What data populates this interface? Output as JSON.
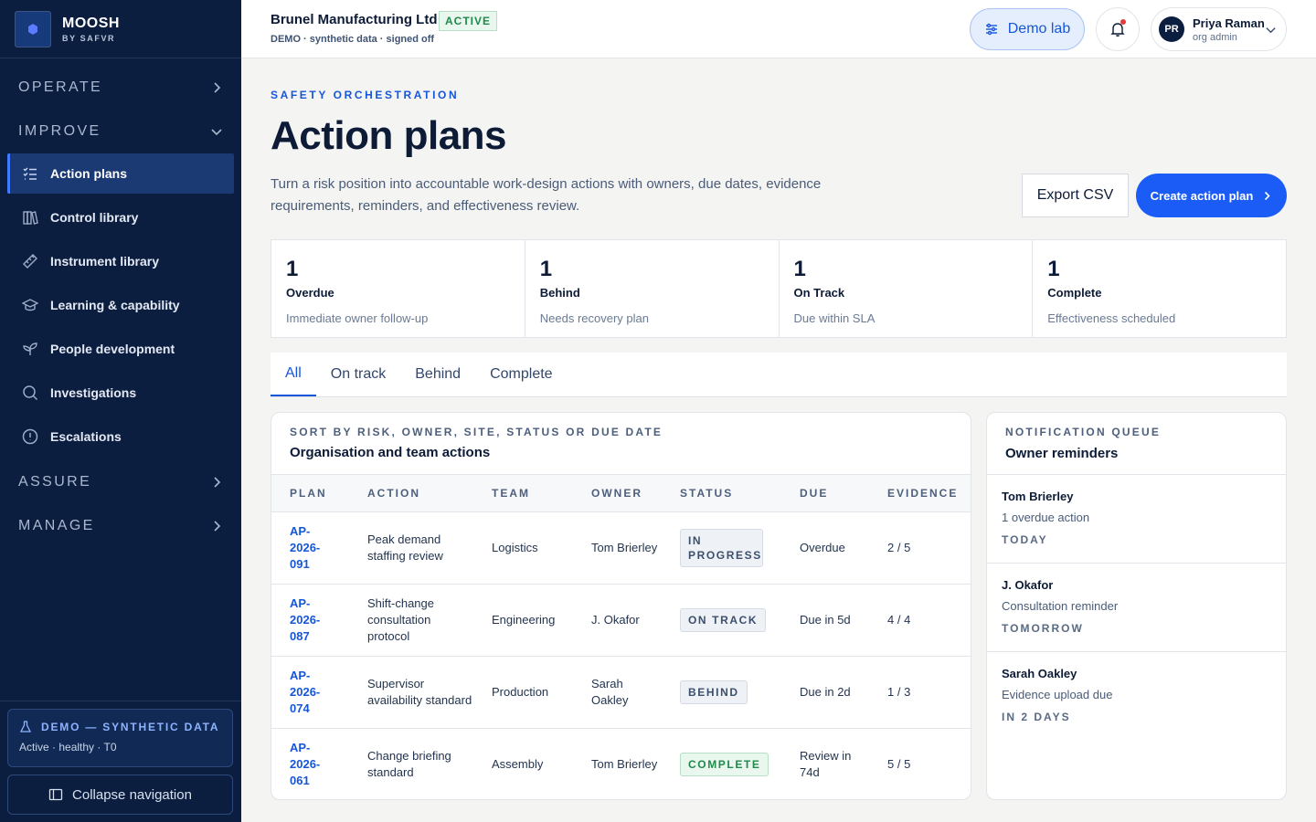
{
  "brand": {
    "name": "MOOSH",
    "sub": "BY SAFVR"
  },
  "sidebar": {
    "groups": [
      {
        "label": "OPERATE"
      },
      {
        "label": "IMPROVE"
      },
      {
        "label": "ASSURE"
      },
      {
        "label": "MANAGE"
      }
    ],
    "items": [
      {
        "label": "Action plans",
        "icon": "checklist-icon"
      },
      {
        "label": "Control library",
        "icon": "books-icon"
      },
      {
        "label": "Instrument library",
        "icon": "ruler-icon"
      },
      {
        "label": "Learning & capability",
        "icon": "graduation-cap-icon"
      },
      {
        "label": "People development",
        "icon": "sprout-icon"
      },
      {
        "label": "Investigations",
        "icon": "search-icon"
      },
      {
        "label": "Escalations",
        "icon": "alert-circle-icon"
      }
    ],
    "demo": {
      "title": "DEMO — SYNTHETIC DATA",
      "status": "Active · healthy · T0"
    },
    "collapse_label": "Collapse navigation"
  },
  "topbar": {
    "org_name": "Brunel Manufacturing Ltd",
    "org_status": "ACTIVE",
    "org_sub": "DEMO · synthetic data · signed off",
    "demo_lab": "Demo lab",
    "user": {
      "initials": "PR",
      "name": "Priya Raman",
      "role": "org admin"
    }
  },
  "header": {
    "eyebrow": "SAFETY ORCHESTRATION",
    "title": "Action plans",
    "description": "Turn a risk position into accountable work-design actions with owners, due dates, evidence requirements, reminders, and effectiveness review.",
    "export_label": "Export CSV",
    "create_label": "Create action plan"
  },
  "stats": [
    {
      "value": "1",
      "label": "Overdue",
      "desc": "Immediate owner follow-up"
    },
    {
      "value": "1",
      "label": "Behind",
      "desc": "Needs recovery plan"
    },
    {
      "value": "1",
      "label": "On Track",
      "desc": "Due within SLA"
    },
    {
      "value": "1",
      "label": "Complete",
      "desc": "Effectiveness scheduled"
    }
  ],
  "tabs": [
    "All",
    "On track",
    "Behind",
    "Complete"
  ],
  "table": {
    "eyebrow": "SORT BY RISK, OWNER, SITE, STATUS OR DUE DATE",
    "title": "Organisation and team actions",
    "columns": [
      "PLAN",
      "ACTION",
      "TEAM",
      "OWNER",
      "STATUS",
      "DUE",
      "EVIDENCE"
    ],
    "rows": [
      {
        "plan": "AP-2026-091",
        "action": "Peak demand staffing review",
        "team": "Logistics",
        "owner": "Tom Brierley",
        "status": "IN PROGRESS",
        "due": "Overdue",
        "evidence": "2 / 5"
      },
      {
        "plan": "AP-2026-087",
        "action": "Shift-change consultation protocol",
        "team": "Engineering",
        "owner": "J. Okafor",
        "status": "ON TRACK",
        "due": "Due in 5d",
        "evidence": "4 / 4"
      },
      {
        "plan": "AP-2026-074",
        "action": "Supervisor availability standard",
        "team": "Production",
        "owner": "Sarah Oakley",
        "status": "BEHIND",
        "due": "Due in 2d",
        "evidence": "1 / 3"
      },
      {
        "plan": "AP-2026-061",
        "action": "Change briefing standard",
        "team": "Assembly",
        "owner": "Tom Brierley",
        "status": "COMPLETE",
        "due": "Review in 74d",
        "evidence": "5 / 5"
      }
    ]
  },
  "notifications": {
    "eyebrow": "NOTIFICATION QUEUE",
    "title": "Owner reminders",
    "items": [
      {
        "name": "Tom Brierley",
        "message": "1 overdue action",
        "when": "TODAY"
      },
      {
        "name": "J. Okafor",
        "message": "Consultation reminder",
        "when": "TOMORROW"
      },
      {
        "name": "Sarah Oakley",
        "message": "Evidence upload due",
        "when": "IN 2 DAYS"
      }
    ]
  },
  "colors": {
    "sidebar_bg": "#0c1e3f",
    "accent": "#1a5cf5",
    "success": "#1f8a4c",
    "alert_dot": "#e23b3b"
  }
}
